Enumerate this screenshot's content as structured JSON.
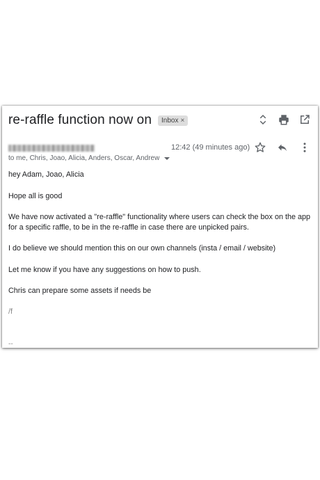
{
  "email": {
    "subject": "re-raffle function now on",
    "label_chip": "Inbox",
    "label_chip_close": "×",
    "time": "12:42 (49 minutes ago)",
    "recipients": "to me, Chris, Joao, Alicia, Anders, Oscar, Andrew",
    "body": {
      "greeting": "hey Adam, Joao, Alicia",
      "p1": "Hope all is good",
      "p2": "We have now activated a \"re-raffle\" functionality where users can check the box on the app for a specific raffle, to be in the re-raffle in case there are unpicked pairs.",
      "p3": "I do believe we should mention this on our own channels (insta / email / website)",
      "p4": "Let me know if you have any suggestions on how to push.",
      "p5": "Chris can prepare some assets if needs be",
      "p6": "/f",
      "signature_sep": "--"
    }
  },
  "icons": {
    "expand": "unfold-icon",
    "print": "print-icon",
    "open_new": "open-in-new-icon",
    "star": "star-icon",
    "reply": "reply-icon",
    "more": "more-vert-icon"
  },
  "colors": {
    "text": "#202124",
    "secondary": "#5f6368",
    "chip_bg": "#dddddd"
  }
}
